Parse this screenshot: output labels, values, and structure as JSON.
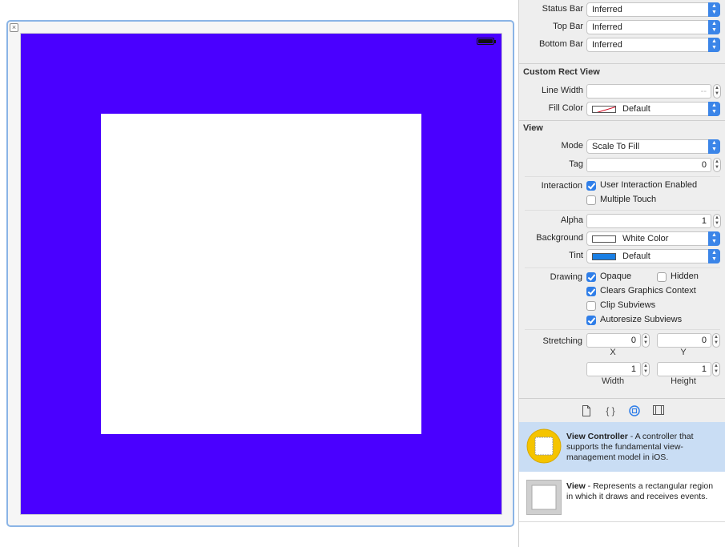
{
  "canvas": {
    "view_background": "#4a00ff",
    "close_icon": "close-icon",
    "battery_icon": "battery-icon"
  },
  "simulated_metrics": {
    "status_bar": {
      "label": "Status Bar",
      "value": "Inferred"
    },
    "top_bar": {
      "label": "Top Bar",
      "value": "Inferred"
    },
    "bottom_bar": {
      "label": "Bottom Bar",
      "value": "Inferred"
    }
  },
  "custom_rect_view": {
    "title": "Custom Rect View",
    "line_width": {
      "label": "Line Width",
      "value": "--"
    },
    "fill_color": {
      "label": "Fill Color",
      "value": "Default"
    }
  },
  "view": {
    "title": "View",
    "mode": {
      "label": "Mode",
      "value": "Scale To Fill"
    },
    "tag": {
      "label": "Tag",
      "value": "0"
    },
    "interaction": {
      "label": "Interaction",
      "user_interaction": {
        "label": "User Interaction Enabled",
        "checked": true
      },
      "multiple_touch": {
        "label": "Multiple Touch",
        "checked": false
      }
    },
    "alpha": {
      "label": "Alpha",
      "value": "1"
    },
    "background": {
      "label": "Background",
      "value": "White Color",
      "swatch": "#ffffff"
    },
    "tint": {
      "label": "Tint",
      "value": "Default",
      "swatch": "#1a7fe4"
    },
    "drawing": {
      "label": "Drawing",
      "opaque": {
        "label": "Opaque",
        "checked": true
      },
      "hidden": {
        "label": "Hidden",
        "checked": false
      },
      "clears_graphics_context": {
        "label": "Clears Graphics Context",
        "checked": true
      },
      "clip_subviews": {
        "label": "Clip Subviews",
        "checked": false
      },
      "autoresize_subviews": {
        "label": "Autoresize Subviews",
        "checked": true
      }
    },
    "stretching": {
      "label": "Stretching",
      "x": {
        "value": "0",
        "caption": "X"
      },
      "y": {
        "value": "0",
        "caption": "Y"
      },
      "width": {
        "value": "1",
        "caption": "Width"
      },
      "height": {
        "value": "1",
        "caption": "Height"
      }
    }
  },
  "library_tabs": [
    "file-template-icon",
    "code-snippet-icon",
    "object-library-icon",
    "media-library-icon"
  ],
  "library": {
    "items": [
      {
        "name": "View Controller",
        "description": " - A controller that supports the fundamental view-management model in iOS."
      },
      {
        "name": "View",
        "description": " - Represents a rectangular region in which it draws and receives events."
      }
    ]
  }
}
